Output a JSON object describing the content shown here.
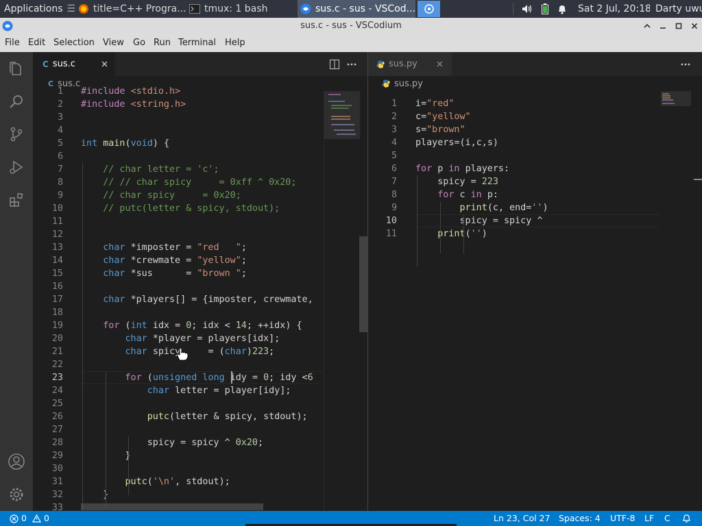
{
  "panel": {
    "applications_label": "Applications",
    "tasks": [
      {
        "label": "title=C++ Progra..."
      },
      {
        "label": "tmux: 1 bash"
      },
      {
        "label": "sus.c - sus - VSCod..."
      }
    ],
    "clock": "Sat  2 Jul, 20:18",
    "user": "Darty uwu"
  },
  "window": {
    "title": "sus.c - sus - VSCodium"
  },
  "menu": [
    "File",
    "Edit",
    "Selection",
    "View",
    "Go",
    "Run",
    "Terminal",
    "Help"
  ],
  "activity_icons": [
    "explorer-icon",
    "search-icon",
    "source-control-icon",
    "run-debug-icon",
    "extensions-icon",
    "account-icon",
    "settings-gear-icon"
  ],
  "left_editor": {
    "tab_label": "sus.c",
    "tab_icon": "C",
    "breadcrumb_icon": "C",
    "breadcrumb": "sus.c",
    "cursor_line": 23,
    "lines": [
      {
        "n": "1",
        "t": "#include <stdio.h>"
      },
      {
        "n": "2",
        "t": "#include <string.h>"
      },
      {
        "n": "3",
        "t": ""
      },
      {
        "n": "4",
        "t": ""
      },
      {
        "n": "5",
        "t": "int main(void) {"
      },
      {
        "n": "6",
        "t": ""
      },
      {
        "n": "7",
        "t": "    // char letter = 'c';"
      },
      {
        "n": "8",
        "t": "    // // char spicy     = 0xff ^ 0x20;"
      },
      {
        "n": "9",
        "t": "    // char spicy     = 0x20;"
      },
      {
        "n": "10",
        "t": "    // putc(letter & spicy, stdout);"
      },
      {
        "n": "11",
        "t": ""
      },
      {
        "n": "12",
        "t": ""
      },
      {
        "n": "13",
        "t": "    char *imposter = \"red   \";"
      },
      {
        "n": "14",
        "t": "    char *crewmate = \"yellow\";"
      },
      {
        "n": "15",
        "t": "    char *sus      = \"brown \";"
      },
      {
        "n": "16",
        "t": ""
      },
      {
        "n": "17",
        "t": "    char *players[] = {imposter, crewmate,"
      },
      {
        "n": "18",
        "t": ""
      },
      {
        "n": "19",
        "t": "    for (int idx = 0; idx < 14; ++idx) {"
      },
      {
        "n": "20",
        "t": "        char *player = players[idx];"
      },
      {
        "n": "21",
        "t": "        char spicy     = (char)223;"
      },
      {
        "n": "22",
        "t": ""
      },
      {
        "n": "23",
        "t": "        for (unsigned long idy = 0; idy <6"
      },
      {
        "n": "24",
        "t": "            char letter = player[idy];"
      },
      {
        "n": "25",
        "t": ""
      },
      {
        "n": "26",
        "t": "            putc(letter & spicy, stdout);"
      },
      {
        "n": "27",
        "t": ""
      },
      {
        "n": "28",
        "t": "            spicy = spicy ^ 0x20;"
      },
      {
        "n": "29",
        "t": "        }"
      },
      {
        "n": "30",
        "t": ""
      },
      {
        "n": "31",
        "t": "        putc('\\n', stdout);"
      },
      {
        "n": "32",
        "t": "    }"
      },
      {
        "n": "33",
        "t": ""
      }
    ]
  },
  "right_editor": {
    "tab_label": "sus.py",
    "tab_icon": "python-icon",
    "breadcrumb": "sus.py",
    "cursor_line": 10,
    "lines": [
      {
        "n": "1",
        "t": "i=\"red\""
      },
      {
        "n": "2",
        "t": "c=\"yellow\""
      },
      {
        "n": "3",
        "t": "s=\"brown\""
      },
      {
        "n": "4",
        "t": "players=(i,c,s)"
      },
      {
        "n": "5",
        "t": ""
      },
      {
        "n": "6",
        "t": "for p in players:"
      },
      {
        "n": "7",
        "t": "    spicy = 223"
      },
      {
        "n": "8",
        "t": "    for c in p:"
      },
      {
        "n": "9",
        "t": "        print(c, end='')"
      },
      {
        "n": "10",
        "t": "        spicy = spicy ^"
      },
      {
        "n": "11",
        "t": "    print('')"
      }
    ]
  },
  "status": {
    "errors": "0",
    "warnings": "0",
    "position": "Ln 23, Col 27",
    "spaces": "Spaces: 4",
    "encoding": "UTF-8",
    "eol": "LF",
    "language": "C"
  },
  "colors": {
    "accent": "#007acc",
    "panel": "#2f343f",
    "editor_bg": "#1e1e1e"
  }
}
